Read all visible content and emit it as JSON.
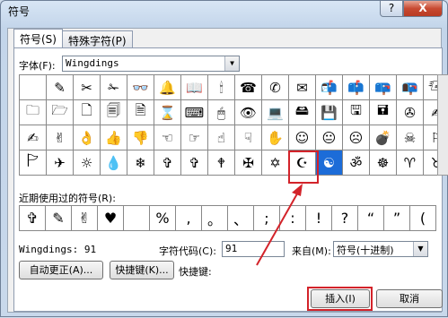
{
  "window": {
    "title": "符号",
    "help_label": "?",
    "close_label": "X"
  },
  "tabs": [
    {
      "label": "符号(S)"
    },
    {
      "label": "特殊字符(P)"
    }
  ],
  "font": {
    "label": "字体(F):",
    "value": "Wingdings"
  },
  "symbols": [
    " ",
    "✎",
    "✂",
    "✁",
    "👓",
    "🔔",
    "📖",
    "🕯",
    "☎",
    "✆",
    "✉",
    "📬",
    "📫",
    "📪",
    "📭",
    "🖅",
    "🗀",
    "🗁",
    "🗋",
    "🗐",
    "🗎",
    "⌛",
    "⌨",
    "🖱",
    "👁",
    "💻",
    "🖴",
    "💾",
    "🖫",
    "🖬",
    "✇",
    "✍",
    "✍",
    "✌",
    "👌",
    "👍",
    "👎",
    "☜",
    "☞",
    "☝",
    "☟",
    "✋",
    "☺",
    "😐",
    "☹",
    "💣",
    "☠",
    "⚐",
    "🏱",
    "✈",
    "☼",
    "💧",
    "❄",
    "✞",
    "✞",
    "🕈",
    "✠",
    "✡",
    "☪",
    "☯",
    "ॐ",
    "☸",
    "♈",
    "♉"
  ],
  "selected_index": 59,
  "recent": {
    "label": "近期使用过的符号(R):",
    "symbols": [
      "✞",
      "✎",
      "✌",
      "♥",
      " ",
      "%",
      ",",
      "。",
      "、",
      ";",
      ":",
      "!",
      "?",
      "“",
      "”",
      "("
    ]
  },
  "char_info": {
    "name": "Wingdings: 91",
    "code_label": "字符代码(C):",
    "code_value": "91",
    "from_label": "来自(M):",
    "from_value": "符号(十进制)"
  },
  "buttons": {
    "autocorrect": "自动更正(A)...",
    "shortcut_key": "快捷键(K)...",
    "shortcut_label": "快捷键:",
    "insert": "插入(I)",
    "cancel": "取消"
  }
}
